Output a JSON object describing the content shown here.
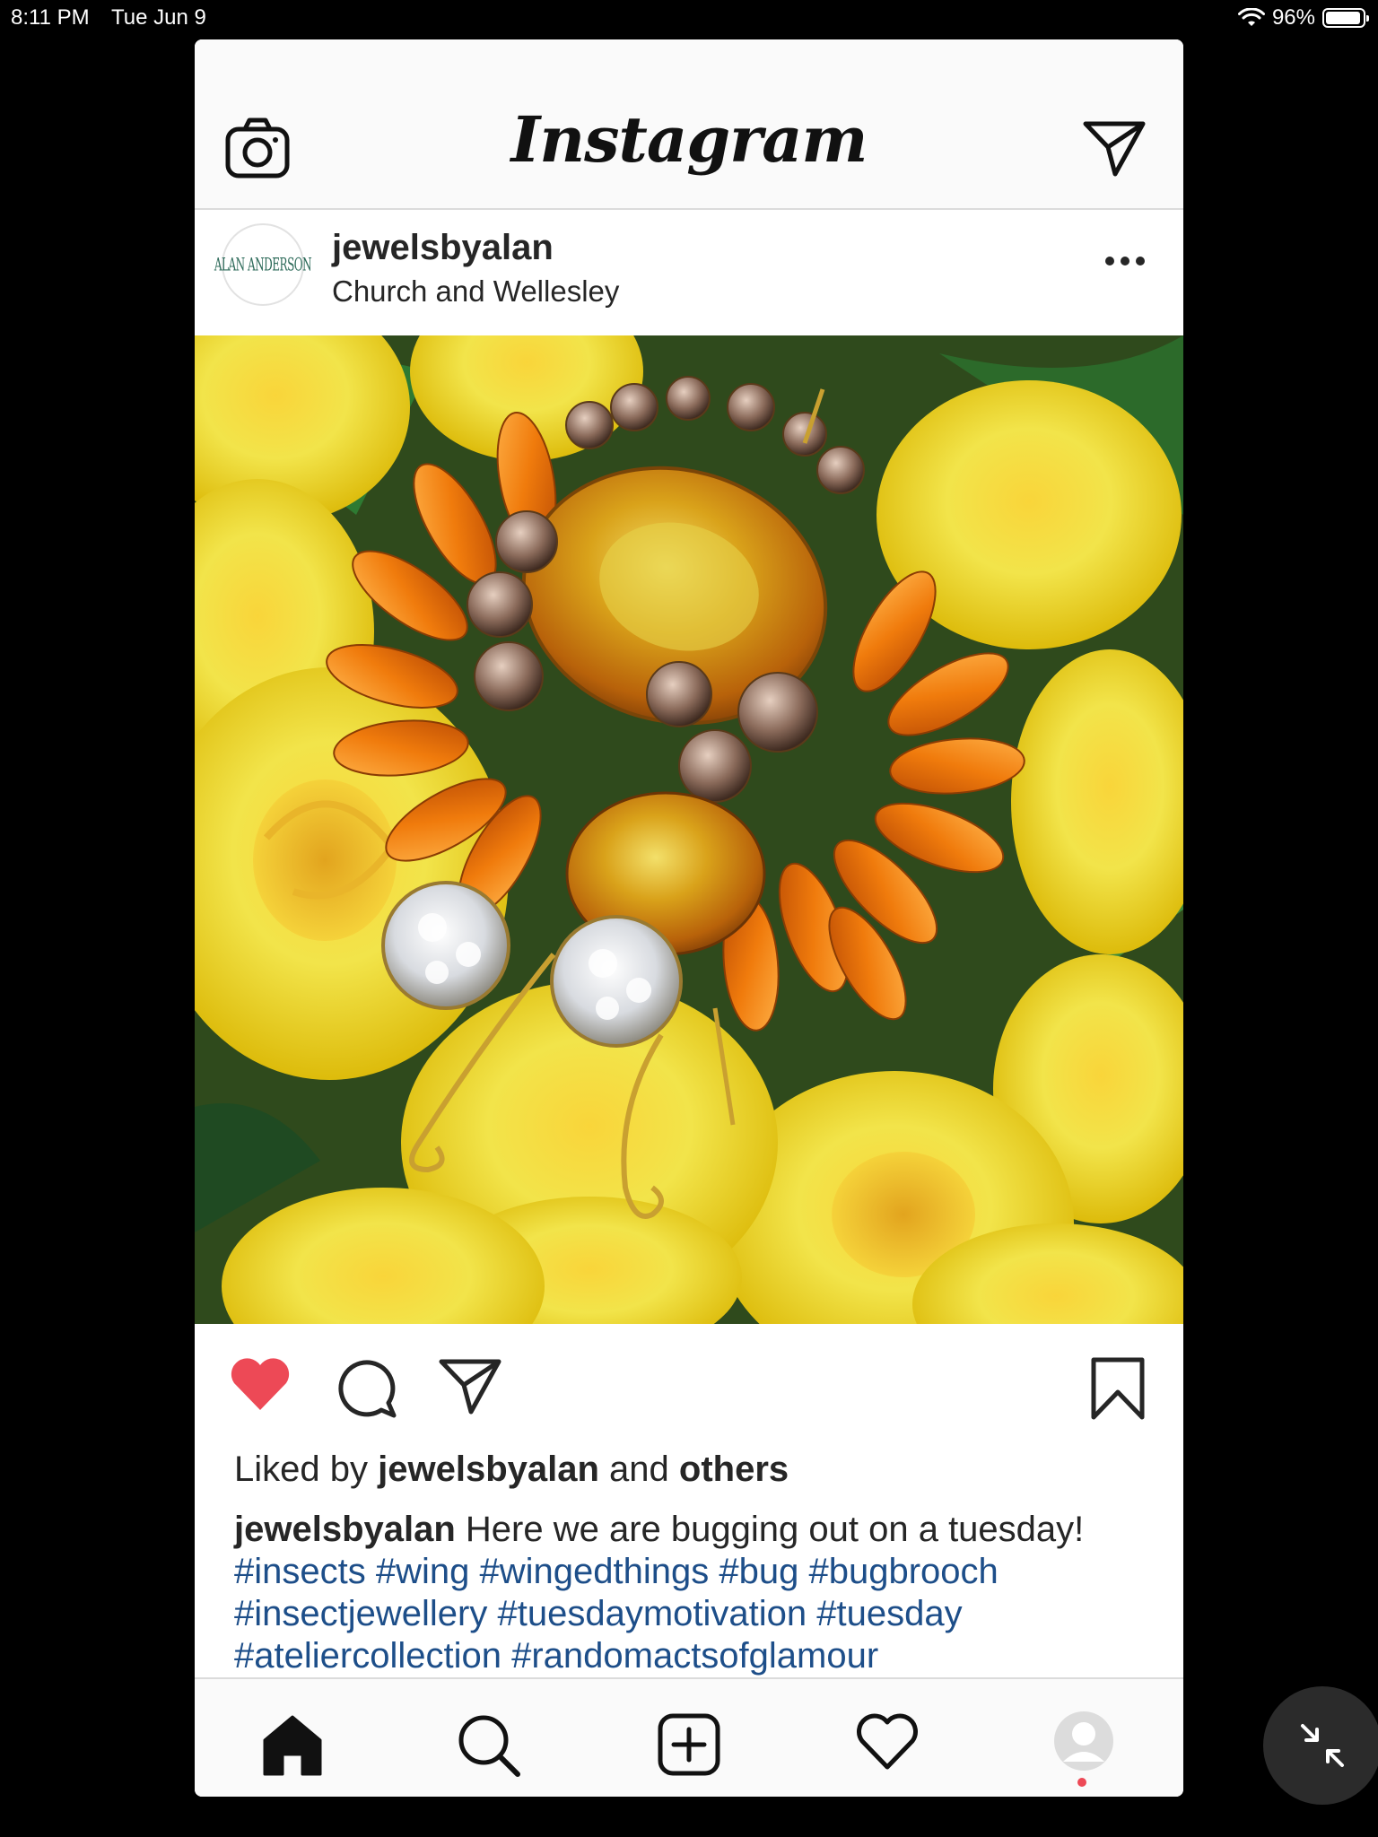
{
  "status_bar": {
    "time": "8:11 PM",
    "date": "Tue Jun 9",
    "battery": "96%"
  },
  "header": {
    "logo": "Instagram"
  },
  "post": {
    "avatar_text": "ALAN ANDERSON",
    "username": "jewelsbyalan",
    "location": "Church and Wellesley",
    "image_alt": "Amber rhinestone bug brooch on yellow roses",
    "liked_by_prefix": "Liked by",
    "liked_by_user": "jewelsbyalan",
    "liked_by_and": "and",
    "liked_by_others": "others",
    "caption_user": "jewelsbyalan",
    "caption_text": "Here we are bugging out on a tuesday!",
    "hashtags": [
      "#insects",
      "#wing",
      "#wingedthings",
      "#bug",
      "#bugbrooch",
      "#insectjewellery",
      "#tuesdaymotivation",
      "#tuesday",
      "#ateliercollection",
      "#randomactsofglamour"
    ]
  },
  "colors": {
    "heart": "#ed4956",
    "hashtag": "#1d4e89",
    "background": "#000000"
  },
  "icons": {
    "header_left": "camera-icon",
    "header_right": "direct-message-icon",
    "post_more": "more-options-icon",
    "actions": [
      "heart-icon",
      "comment-icon",
      "share-icon",
      "bookmark-icon"
    ],
    "tabs": [
      "home-icon",
      "search-icon",
      "new-post-icon",
      "activity-heart-icon",
      "profile-icon"
    ],
    "overlay": "minimize-icon"
  }
}
